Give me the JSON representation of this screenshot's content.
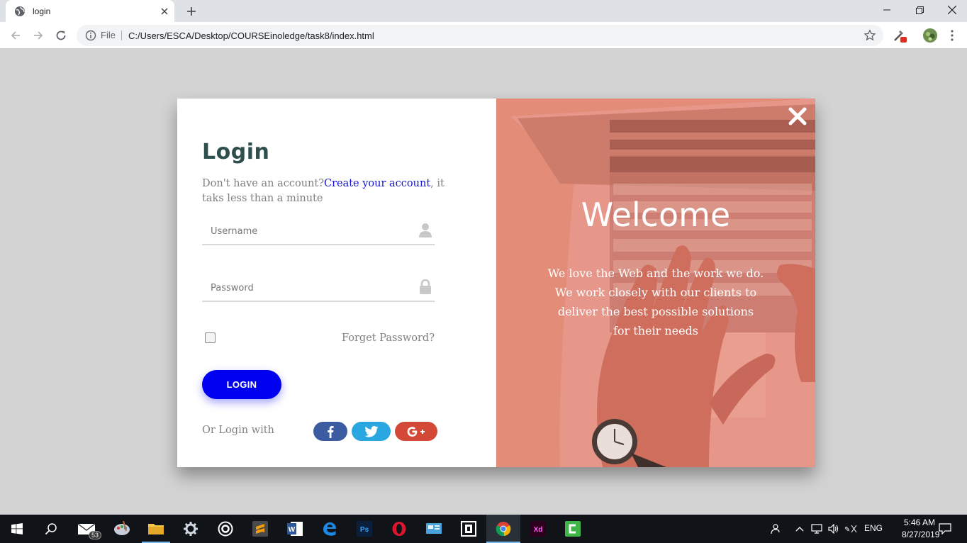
{
  "browser": {
    "tab_title": "login",
    "url_scheme_label": "File",
    "url": "C:/Users/ESCA/Desktop/COURSEinoledge/task8/index.html"
  },
  "login": {
    "title": "Login",
    "signup_prefix": "Don't have an account?",
    "signup_link": "Create your account",
    "signup_suffix": ", it taks less than a minute",
    "username_placeholder": "Username",
    "password_placeholder": "Password",
    "remember_checked": false,
    "forget_password": "Forget Password?",
    "login_button": "LOGIN",
    "or_login_with": "Or Login with",
    "social": [
      "facebook",
      "twitter",
      "google-plus"
    ],
    "colors": {
      "primary": "#0000f0",
      "facebook": "#3b5ca0",
      "twitter": "#2aa6e0",
      "google": "#d34836",
      "title": "#2f4f4f"
    }
  },
  "welcome": {
    "heading": "Welcome",
    "line1": "We love the Web and the work we do.",
    "line2": "We work closely with our clients to",
    "line3": "deliver the best possible solutions",
    "line4": "for their needs",
    "overlay_color": "#e38c78"
  },
  "taskbar": {
    "mail_badge": "53",
    "language": "ENG",
    "time": "5:46 AM",
    "date": "8/27/2019"
  }
}
